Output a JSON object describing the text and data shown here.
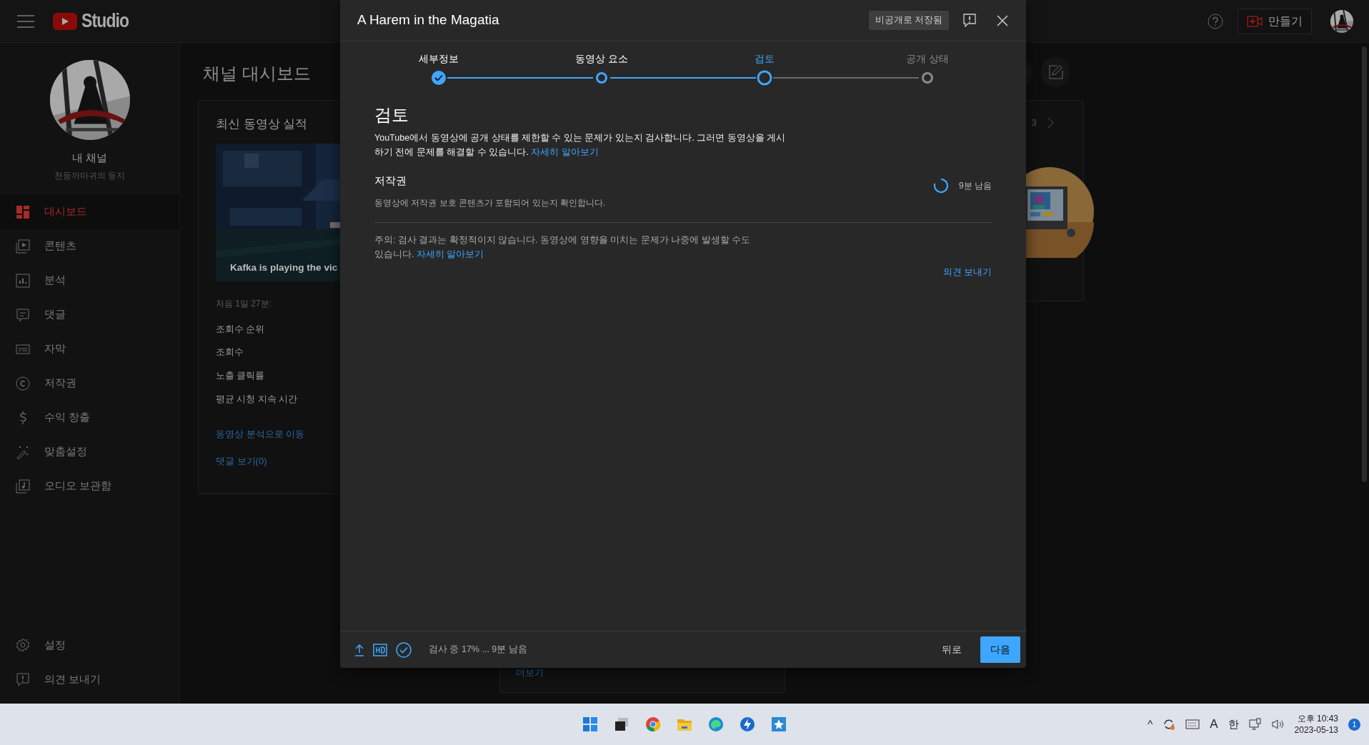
{
  "app": {
    "logo_text": "Studio",
    "create_button": "만들기"
  },
  "channel": {
    "title": "내 채널",
    "subtitle": "천둥까마귀의 둥지"
  },
  "sidebar": {
    "items": [
      {
        "label": "대시보드",
        "selected": true
      },
      {
        "label": "콘텐츠",
        "selected": false
      },
      {
        "label": "분석",
        "selected": false
      },
      {
        "label": "댓글",
        "selected": false
      },
      {
        "label": "자막",
        "selected": false
      },
      {
        "label": "저작권",
        "selected": false
      },
      {
        "label": "수익 창출",
        "selected": false
      },
      {
        "label": "맞춤설정",
        "selected": false
      },
      {
        "label": "오디오 보관함",
        "selected": false
      }
    ],
    "bottom_items": [
      {
        "label": "설정"
      },
      {
        "label": "의견 보내기"
      }
    ]
  },
  "dashboard": {
    "title": "채널 대시보드",
    "latest_video_card": {
      "title": "최신 동영상 실적",
      "video_caption": "Kafka is playing the vic",
      "period": "처음 1일 27분:",
      "metrics": [
        "조회수 순위",
        "조회수",
        "노출 클릭률",
        "평균 시청 지속 시간"
      ],
      "links": [
        "동영상 분석으로 이동",
        "댓글 보기(0)"
      ]
    },
    "middle_card": {
      "more_link": "더보기"
    },
    "right_card": {
      "pager": "3"
    }
  },
  "dialog": {
    "title": "A Harem in the Magatia",
    "saved_badge": "비공개로 저장됨",
    "steps": [
      {
        "label": "세부정보",
        "completed": true,
        "reached": true,
        "selected": false
      },
      {
        "label": "동영상 요소",
        "completed": false,
        "reached": true,
        "selected": false
      },
      {
        "label": "검토",
        "completed": false,
        "reached": true,
        "selected": true
      },
      {
        "label": "공개 상태",
        "completed": false,
        "reached": false,
        "selected": false
      }
    ],
    "heading": "검토",
    "description": "YouTube에서 동영상에 공개 상태를 제한할 수 있는 문제가 있는지 검사합니다. 그러면 동영상을 게시하기 전에 문제를 해결할 수 있습니다.",
    "description_link": "자세히 알아보기",
    "checks": [
      {
        "title": "저작권",
        "description": "동영상에 저작권 보호 콘텐츠가 포함되어 있는지 확인합니다.",
        "status_text": "9분 남음"
      }
    ],
    "note": "주의: 검사 결과는 확정적이지 않습니다. 동영상에 영향을 미치는 문제가 나중에 발생할 수도 있습니다.",
    "note_link": "자세히 알아보기",
    "feedback_link": "의견 보내기",
    "footer": {
      "status": "검사 중 17% ... 9분 남음",
      "back_button": "뒤로",
      "next_button": "다음"
    }
  },
  "taskbar": {
    "tray_caret": "^",
    "input_mode": "A",
    "ime": "한",
    "time": "오후 10:43",
    "date": "2023-05-13",
    "notification_count": "1"
  }
}
